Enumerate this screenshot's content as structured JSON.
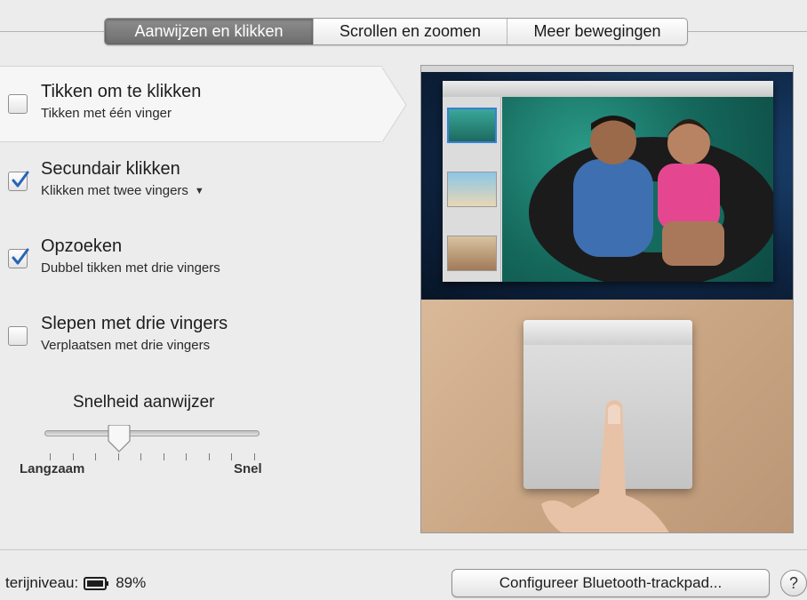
{
  "tabs": [
    {
      "label": "Aanwijzen en klikken",
      "active": true
    },
    {
      "label": "Scrollen en zoomen",
      "active": false
    },
    {
      "label": "Meer bewegingen",
      "active": false
    }
  ],
  "options": [
    {
      "title": "Tikken om te klikken",
      "subtitle": "Tikken met één vinger",
      "checked": false,
      "selected": true
    },
    {
      "title": "Secundair klikken",
      "subtitle": "Klikken met twee vingers",
      "checked": true,
      "has_dropdown": true
    },
    {
      "title": "Opzoeken",
      "subtitle": "Dubbel tikken met drie vingers",
      "checked": true
    },
    {
      "title": "Slepen met drie vingers",
      "subtitle": "Verplaatsen met drie vingers",
      "checked": false
    }
  ],
  "pointer_speed": {
    "title": "Snelheid aanwijzer",
    "min_label": "Langzaam",
    "max_label": "Snel",
    "value": 0.34,
    "tick_count": 10
  },
  "footer": {
    "battery_label": "terijniveau:",
    "battery_value": "89%",
    "configure_button": "Configureer Bluetooth-trackpad...",
    "help_button": "?"
  },
  "colors": {
    "accent_check": "#2a64b8",
    "active_tab": "#7a7a7a",
    "background": "#ececec"
  },
  "icons": {
    "checkbox_check": "checkmark-icon",
    "dropdown": "triangle-down-icon",
    "battery": "battery-icon",
    "help": "help-icon"
  }
}
